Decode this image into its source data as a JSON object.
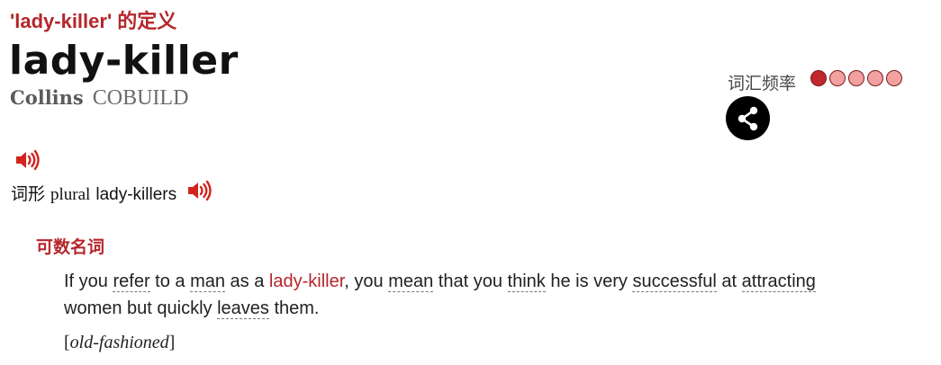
{
  "definition_heading": "'lady-killer' 的定义",
  "headword": "lady-killer",
  "source": {
    "brand": "Collins",
    "series": "COBUILD"
  },
  "word_forms": {
    "label": "词形",
    "grammar": "plural",
    "form": "lady-killers"
  },
  "frequency": {
    "label": "词汇频率",
    "filled": 1,
    "total": 5
  },
  "icons": {
    "sound": "speaker-icon",
    "share": "share-icon"
  },
  "colors": {
    "accent": "#b5262b",
    "dot_on": "#c1272d",
    "dot_off": "#f3a0a0"
  },
  "sense": {
    "part_of_speech": "可数名词",
    "definition": {
      "t1": "If you ",
      "refer": "refer",
      "t2": " to a ",
      "man": "man",
      "t3": " as a ",
      "headword": "lady-killer",
      "t4": ", you ",
      "mean": "mean",
      "t5": " that you ",
      "think": "think",
      "t6": " he is very ",
      "successful": "successful",
      "t7": " at ",
      "attracting": "attracting",
      "t8": " women but quickly ",
      "leaves": "leaves",
      "t9": " them."
    },
    "register": {
      "open": "[",
      "label": "old-fashioned",
      "close": "]"
    }
  }
}
